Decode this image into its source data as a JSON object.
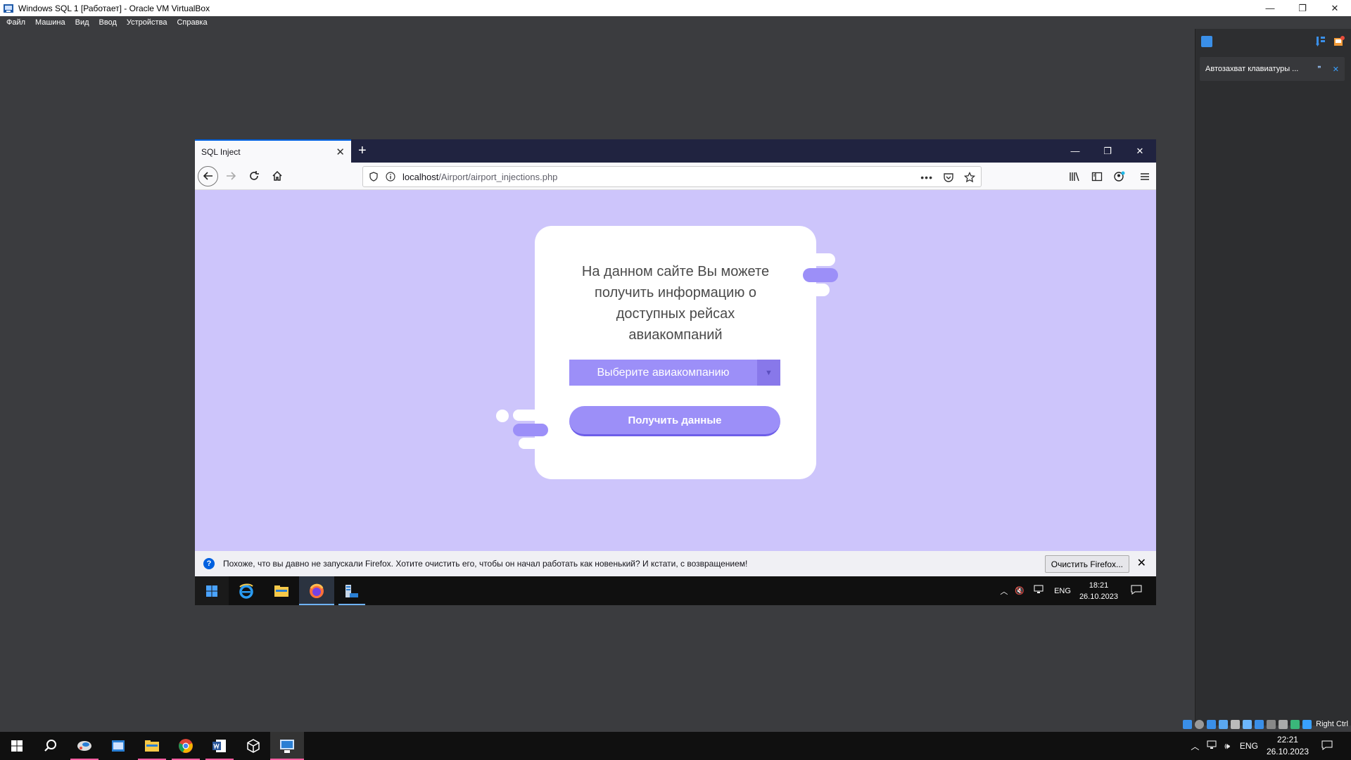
{
  "host_window": {
    "title": "Windows SQL 1 [Работает] - Oracle VM VirtualBox",
    "controls": [
      "—",
      "❐",
      "✕"
    ]
  },
  "vb_menu": [
    "Файл",
    "Машина",
    "Вид",
    "Ввод",
    "Устройства",
    "Справка"
  ],
  "vb_sidebar": {
    "notice": "Автозахват клавиатуры ..."
  },
  "firefox": {
    "tab_title": "SQL Inject",
    "url_host": "localhost",
    "url_path": "/Airport/airport_injections.php",
    "notification": {
      "text": "Похоже, что вы давно не запускали Firefox. Хотите очистить его, чтобы он начал работать как новенький? И кстати, с возвращением!",
      "button": "Очистить Firefox..."
    }
  },
  "page": {
    "message": "На данном сайте Вы можете получить информацию о доступных рейсах авиакомпаний",
    "select_label": "Выберите авиакомпанию",
    "submit_label": "Получить данные",
    "colors": {
      "background": "#cdc5fb",
      "accent": "#9c8ff8"
    }
  },
  "guest_taskbar": {
    "lang": "ENG",
    "time": "18:21",
    "date": "26.10.2023"
  },
  "host_taskbar": {
    "lang": "ENG",
    "time": "22:21",
    "date": "26.10.2023"
  },
  "vb_status": {
    "host_key": "Right Ctrl"
  }
}
